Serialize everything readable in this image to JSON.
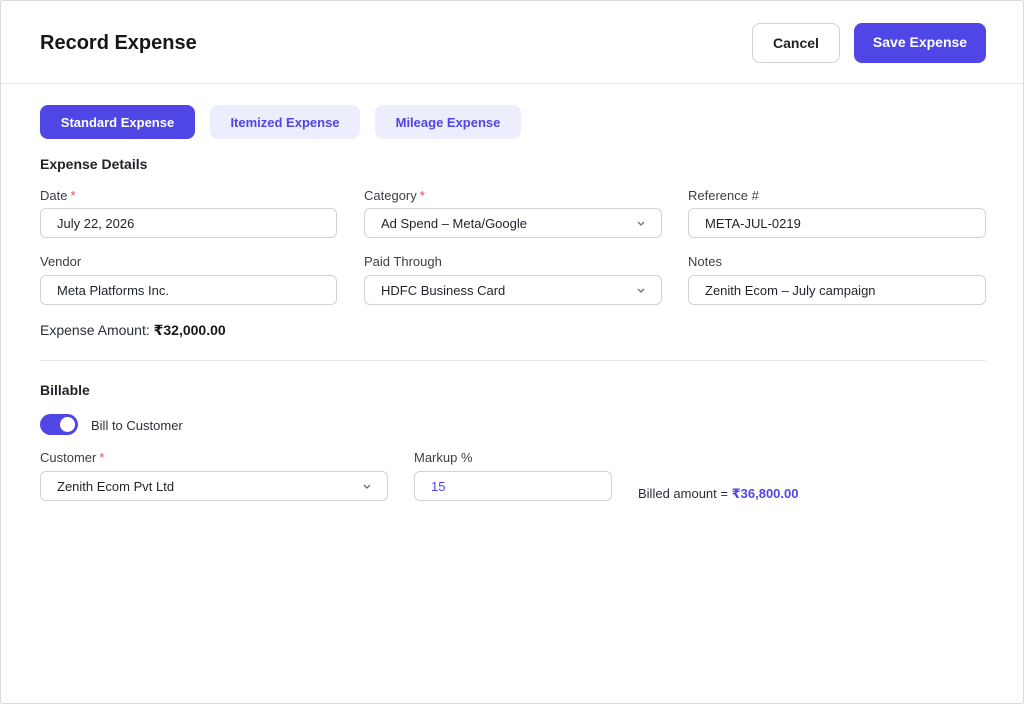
{
  "header": {
    "title": "Record Expense",
    "cancel_label": "Cancel",
    "save_label": "Save Expense"
  },
  "tabs": [
    {
      "label": "Standard Expense",
      "active": true
    },
    {
      "label": "Itemized Expense",
      "active": false
    },
    {
      "label": "Mileage Expense",
      "active": false
    }
  ],
  "details": {
    "section_title": "Expense Details",
    "date": {
      "label": "Date",
      "required": "*",
      "value": "July 22, 2026"
    },
    "category": {
      "label": "Category",
      "required": "*",
      "value": "Ad Spend – Meta/Google"
    },
    "reference": {
      "label": "Reference #",
      "value": "META-JUL-0219"
    },
    "vendor": {
      "label": "Vendor",
      "value": "Meta Platforms Inc."
    },
    "paid_through": {
      "label": "Paid Through",
      "value": "HDFC Business Card"
    },
    "notes": {
      "label": "Notes",
      "value": "Zenith Ecom – July campaign"
    },
    "amount_label": "Expense Amount:",
    "amount_value": "₹32,000.00"
  },
  "billable": {
    "section_title": "Billable",
    "toggle_label": "Bill to Customer",
    "toggle_on": true,
    "customer": {
      "label": "Customer",
      "required": "*",
      "value": "Zenith Ecom Pvt Ltd"
    },
    "markup": {
      "label": "Markup %",
      "value": "15"
    },
    "billed_label": "Billed amount =",
    "billed_value": "₹36,800.00"
  },
  "colors": {
    "accent": "#4f46e5",
    "tab_inactive_bg": "#eceefd",
    "required": "#e5484d"
  }
}
